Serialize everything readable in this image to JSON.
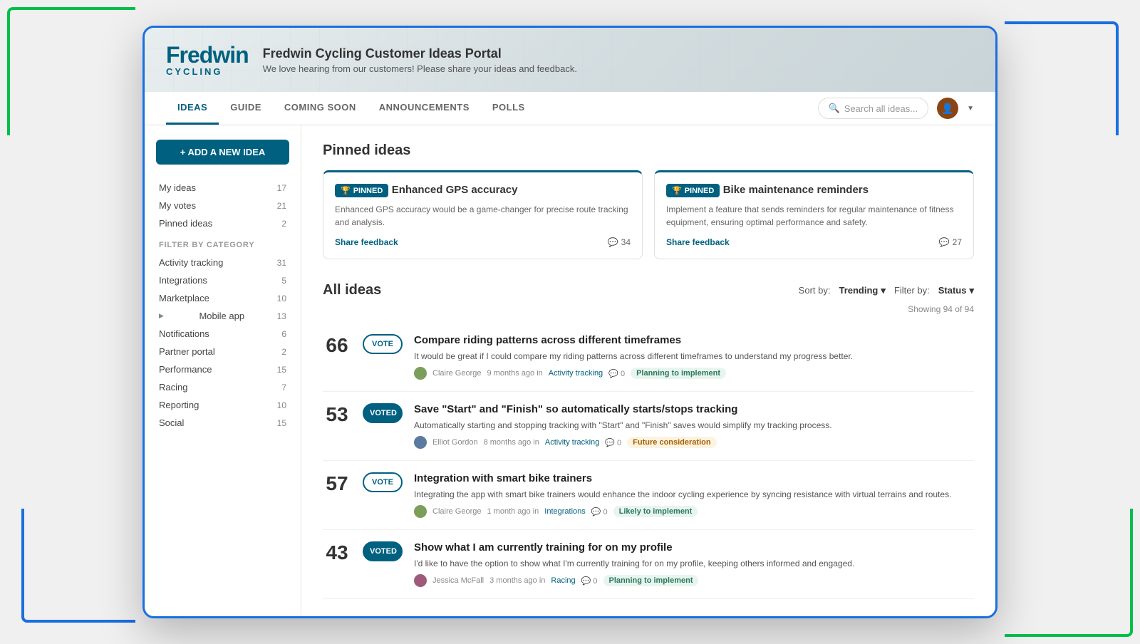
{
  "decorative": true,
  "logo": {
    "name": "Fredwin",
    "sub": "CYCLING"
  },
  "header": {
    "title": "Fredwin Cycling Customer Ideas Portal",
    "subtitle": "We love hearing from our customers! Please share your ideas and feedback."
  },
  "nav": {
    "tabs": [
      {
        "label": "IDEAS",
        "active": true
      },
      {
        "label": "GUIDE",
        "active": false
      },
      {
        "label": "COMING SOON",
        "active": false
      },
      {
        "label": "ANNOUNCEMENTS",
        "active": false
      },
      {
        "label": "POLLS",
        "active": false
      }
    ],
    "search_placeholder": "Search all ideas...",
    "avatar_initial": "👤"
  },
  "sidebar": {
    "add_btn": "+ ADD A NEW IDEA",
    "my_items": [
      {
        "label": "My ideas",
        "count": 17
      },
      {
        "label": "My votes",
        "count": 21
      },
      {
        "label": "Pinned ideas",
        "count": 2
      }
    ],
    "filter_heading": "FILTER BY CATEGORY",
    "categories": [
      {
        "label": "Activity tracking",
        "count": 31,
        "arrow": false
      },
      {
        "label": "Integrations",
        "count": 5,
        "arrow": false
      },
      {
        "label": "Marketplace",
        "count": 10,
        "arrow": false
      },
      {
        "label": "Mobile app",
        "count": 13,
        "arrow": true
      },
      {
        "label": "Notifications",
        "count": 6,
        "arrow": false
      },
      {
        "label": "Partner portal",
        "count": 2,
        "arrow": false
      },
      {
        "label": "Performance",
        "count": 15,
        "arrow": false
      },
      {
        "label": "Racing",
        "count": 7,
        "arrow": false
      },
      {
        "label": "Reporting",
        "count": 10,
        "arrow": false
      },
      {
        "label": "Social",
        "count": 15,
        "arrow": false
      }
    ]
  },
  "pinned_section": {
    "title": "Pinned ideas",
    "cards": [
      {
        "badge": "PINNED",
        "title": "Enhanced GPS accuracy",
        "desc": "Enhanced GPS accuracy would be a game-changer for precise route tracking and analysis.",
        "share_label": "Share feedback",
        "comments": 34
      },
      {
        "badge": "PINNED",
        "title": "Bike maintenance reminders",
        "desc": "Implement a feature that sends reminders for regular maintenance of fitness equipment, ensuring optimal performance and safety.",
        "share_label": "Share feedback",
        "comments": 27
      }
    ]
  },
  "all_ideas_section": {
    "title": "All ideas",
    "sort_label": "Sort by:",
    "sort_value": "Trending",
    "filter_label": "Filter by:",
    "filter_value": "Status",
    "showing_text": "Showing 94 of 94",
    "ideas": [
      {
        "votes": 66,
        "vote_btn_label": "VOTE",
        "voted": false,
        "title": "Compare riding patterns across different timeframes",
        "desc": "It would be great if I could compare my riding patterns across different timeframes to understand my progress better.",
        "author": "Claire George",
        "time_ago": "9 months ago",
        "category": "Activity tracking",
        "comments": 0,
        "status": "Planning to implement",
        "status_class": "status-planning"
      },
      {
        "votes": 53,
        "vote_btn_label": "VOTED",
        "voted": true,
        "title": "Save \"Start\" and \"Finish\" so automatically starts/stops tracking",
        "desc": "Automatically starting and stopping tracking with \"Start\" and \"Finish\" saves would simplify my tracking process.",
        "author": "Elliot Gordon",
        "time_ago": "8 months ago",
        "category": "Activity tracking",
        "comments": 0,
        "status": "Future consideration",
        "status_class": "status-future"
      },
      {
        "votes": 57,
        "vote_btn_label": "VOTE",
        "voted": false,
        "title": "Integration with smart bike trainers",
        "desc": "Integrating the app with smart bike trainers would enhance the indoor cycling experience by syncing resistance with virtual terrains and routes.",
        "author": "Claire George",
        "time_ago": "1 month ago",
        "category": "Integrations",
        "comments": 0,
        "status": "Likely to implement",
        "status_class": "status-likely"
      },
      {
        "votes": 43,
        "vote_btn_label": "VOTED",
        "voted": true,
        "title": "Show what I am currently training for on my profile",
        "desc": "I'd like to have the option to show what I'm currently training for on my profile, keeping others informed and engaged.",
        "author": "Jessica McFall",
        "time_ago": "3 months ago",
        "category": "Racing",
        "comments": 0,
        "status": "Planning to implement",
        "status_class": "status-planning"
      }
    ]
  }
}
